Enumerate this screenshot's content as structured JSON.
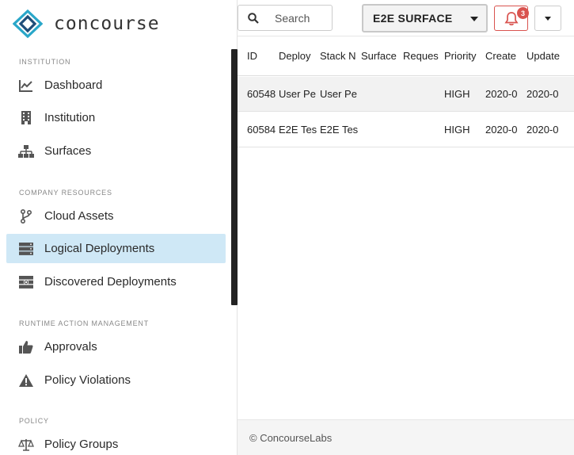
{
  "app": {
    "name": "concourse"
  },
  "sidebar": {
    "sections": [
      {
        "label": "INSTITUTION"
      },
      {
        "label": "COMPANY RESOURCES"
      },
      {
        "label": "RUNTIME ACTION MANAGEMENT"
      },
      {
        "label": "POLICY"
      }
    ],
    "items": [
      {
        "label": "Dashboard",
        "icon": "chart-line-icon"
      },
      {
        "label": "Institution",
        "icon": "building-icon"
      },
      {
        "label": "Surfaces",
        "icon": "sitemap-icon"
      },
      {
        "label": "Cloud Assets",
        "icon": "code-branch-icon"
      },
      {
        "label": "Logical Deployments",
        "icon": "server-icon",
        "active": true
      },
      {
        "label": "Discovered Deployments",
        "icon": "discovered-server-icon"
      },
      {
        "label": "Approvals",
        "icon": "thumbs-up-icon"
      },
      {
        "label": "Policy Violations",
        "icon": "warning-icon"
      },
      {
        "label": "Policy Groups",
        "icon": "balance-scale-icon"
      }
    ]
  },
  "topbar": {
    "search_label": "Search",
    "surface_value": "E2E SURFACE",
    "notification_count": "3"
  },
  "table": {
    "columns": [
      "ID",
      "Deploy",
      "Stack N",
      "Surface",
      "Reques",
      "Priority",
      "Create",
      "Update"
    ],
    "rows": [
      [
        "60548",
        "User Pe",
        "User Pe",
        "",
        "",
        "HIGH",
        "2020-0",
        "2020-0"
      ],
      [
        "60584",
        "E2E Tes",
        "E2E Tes",
        "",
        "",
        "HIGH",
        "2020-0",
        "2020-0"
      ]
    ]
  },
  "footer": {
    "text": "© ConcourseLabs"
  },
  "colors": {
    "accent": "#2aa7c9",
    "active_bg": "#cfe8f6",
    "alert": "#d9534f"
  }
}
